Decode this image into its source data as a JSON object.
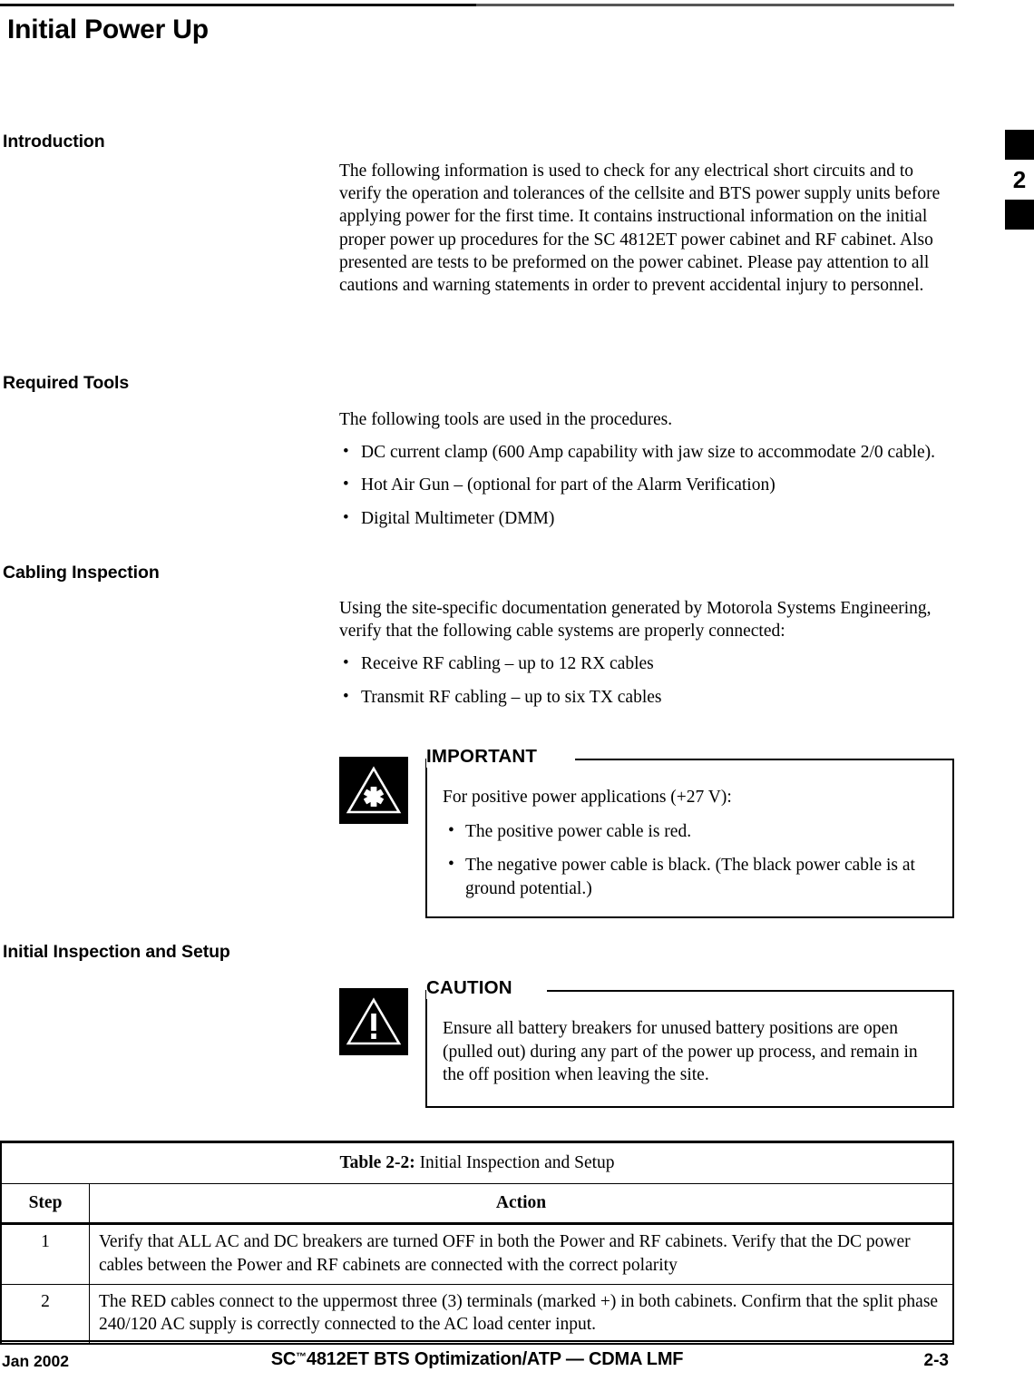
{
  "chapter_tab": {
    "number": "2"
  },
  "page_title": "Initial Power Up",
  "sections": [
    {
      "heading": "Introduction",
      "paragraph": "The following information is used to check for any electrical short circuits and to verify the operation and tolerances of the cellsite and BTS power supply units before applying power for the first time. It contains instructional information on the initial proper power up procedures for the SC 4812ET power cabinet and RF cabinet. Also presented are tests to be preformed on the power cabinet. Please pay attention to all cautions and warning statements in order to prevent accidental injury to personnel."
    },
    {
      "heading": "Required Tools",
      "paragraph": "The following tools are used in the procedures.",
      "bullets": [
        "DC current clamp (600 Amp capability with jaw size to accommodate 2/0 cable).",
        "Hot Air Gun – (optional for part of the Alarm Verification)",
        "Digital Multimeter (DMM)"
      ]
    },
    {
      "heading": "Cabling Inspection",
      "paragraph": "Using the site-specific documentation generated by Motorola Systems Engineering, verify that the following cable systems are properly connected:",
      "bullets": [
        "Receive RF cabling – up to 12 RX cables",
        "Transmit RF cabling – up to six TX cables"
      ]
    },
    {
      "heading": "Initial Inspection and Setup"
    }
  ],
  "important_callout": {
    "label": "IMPORTANT",
    "icon": "asterisk-triangle-icon",
    "paragraph": "For positive power applications (+27 V):",
    "bullets": [
      "The positive power cable is red.",
      "The negative power cable is black. (The black power cable is at ground potential.)"
    ]
  },
  "caution_callout": {
    "label": "CAUTION",
    "icon": "warning-triangle-icon",
    "paragraph": "Ensure all battery breakers for unused battery positions are open (pulled out) during any part of the power up process, and remain in the off position when leaving the site."
  },
  "table": {
    "caption_label": "Table 2-2:",
    "caption_text": " Initial Inspection and Setup",
    "columns": [
      "Step",
      "Action"
    ],
    "rows": [
      {
        "step": "1",
        "action": "Verify that ALL AC and DC breakers are turned OFF in both the Power and RF cabinets. Verify that the DC power cables between the Power and RF cabinets are connected with the correct polarity"
      },
      {
        "step": "2",
        "action": "The RED cables  connect to the uppermost three (3) terminals (marked +) in both cabinets. Confirm that the split phase 240/120 AC supply is correctly connected to the AC load center input."
      }
    ]
  },
  "footer": {
    "date": "Jan 2002",
    "title_pre": "SC",
    "title_tm": "™",
    "title_post": "4812ET BTS Optimization/ATP — CDMA LMF",
    "page_number": "2-3"
  }
}
